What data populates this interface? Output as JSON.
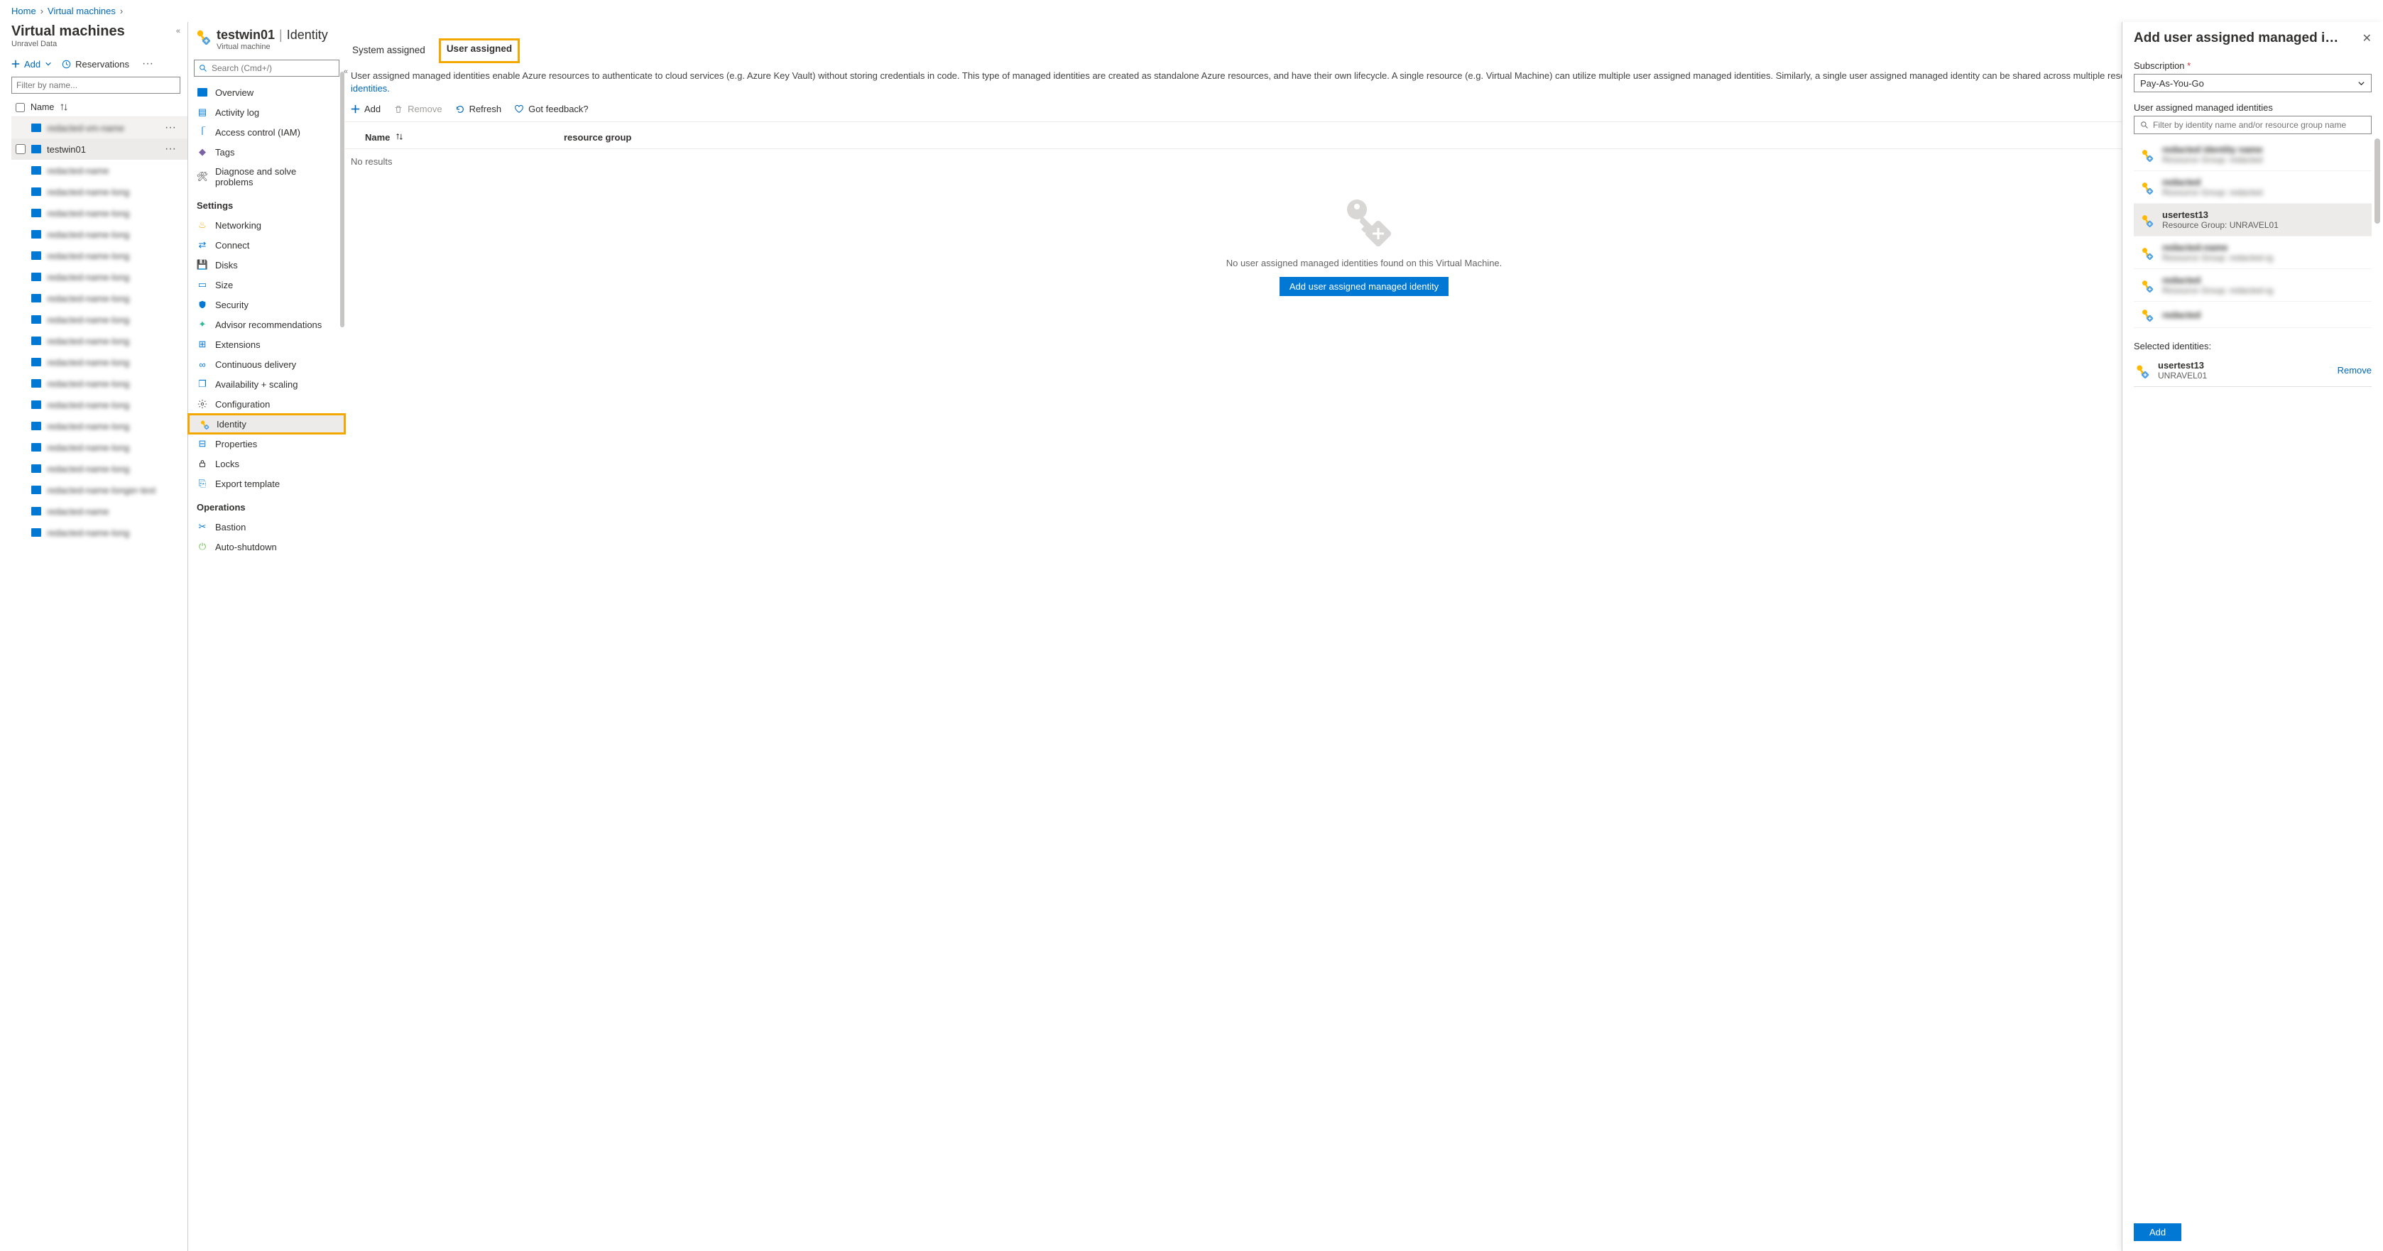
{
  "breadcrumbs": {
    "home": "Home",
    "vms": "Virtual machines"
  },
  "vmlist": {
    "title": "Virtual machines",
    "subtitle": "Unravel Data",
    "add_label": "Add",
    "reservations_label": "Reservations",
    "filter_placeholder": "Filter by name...",
    "col_name": "Name",
    "selected_vm": "testwin01"
  },
  "resource": {
    "name": "testwin01",
    "section": "Identity",
    "type_sub": "Virtual machine",
    "search_placeholder": "Search (Cmd+/)"
  },
  "menu": {
    "overview": "Overview",
    "activity_log": "Activity log",
    "iam": "Access control (IAM)",
    "tags": "Tags",
    "diagnose": "Diagnose and solve problems",
    "settings_header": "Settings",
    "networking": "Networking",
    "connect": "Connect",
    "disks": "Disks",
    "size": "Size",
    "security": "Security",
    "advisor": "Advisor recommendations",
    "extensions": "Extensions",
    "cd": "Continuous delivery",
    "availability": "Availability + scaling",
    "configuration": "Configuration",
    "identity": "Identity",
    "properties": "Properties",
    "locks": "Locks",
    "export_template": "Export template",
    "operations_header": "Operations",
    "bastion": "Bastion",
    "auto_shutdown": "Auto-shutdown"
  },
  "tabs": {
    "system": "System assigned",
    "user": "User assigned"
  },
  "description": {
    "text": "User assigned managed identities enable Azure resources to authenticate to cloud services (e.g. Azure Key Vault) without storing credentials in code. This type of managed identities are created as standalone Azure resources, and have their own lifecycle. A single resource (e.g. Virtual Machine) can utilize multiple user assigned managed identities. Similarly, a single user assigned managed identity can be shared across multiple resources (e.g. Virtual Machine). ",
    "link": "Learn more about Managed identities."
  },
  "cmdbar": {
    "add": "Add",
    "remove": "Remove",
    "refresh": "Refresh",
    "feedback": "Got feedback?"
  },
  "table": {
    "col_name": "Name",
    "col_rg": "resource group",
    "no_results": "No results",
    "empty_msg": "No user assigned managed identities found on this Virtual Machine.",
    "cta": "Add user assigned managed identity"
  },
  "panel": {
    "title": "Add user assigned managed i…",
    "subscription_label": "Subscription",
    "subscription_value": "Pay-As-You-Go",
    "uami_label": "User assigned managed identities",
    "filter_placeholder": "Filter by identity name and/or resource group name",
    "selected_identity": {
      "name": "usertest13",
      "rg": "Resource Group: UNRAVEL01"
    },
    "selected_heading": "Selected identities:",
    "selected_display": {
      "name": "usertest13",
      "rg": "UNRAVEL01"
    },
    "remove": "Remove",
    "add": "Add"
  }
}
